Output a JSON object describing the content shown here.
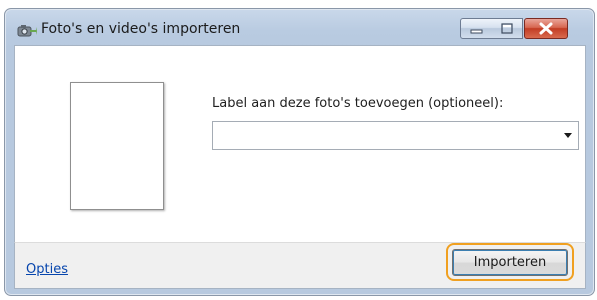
{
  "window": {
    "title": "Foto's en video's importeren",
    "icon": "camera-import-icon",
    "controls": [
      "minimize-icon",
      "maximize-icon",
      "close-icon"
    ]
  },
  "main": {
    "tag_label": "Label aan deze foto's toevoegen (optioneel):",
    "tag_input": {
      "value": "",
      "placeholder": ""
    }
  },
  "footer": {
    "options_link": "Opties",
    "import_button": "Importeren"
  },
  "colors": {
    "link": "#0645ad",
    "highlight": "#f0a020",
    "close_button": "#c23c24"
  }
}
